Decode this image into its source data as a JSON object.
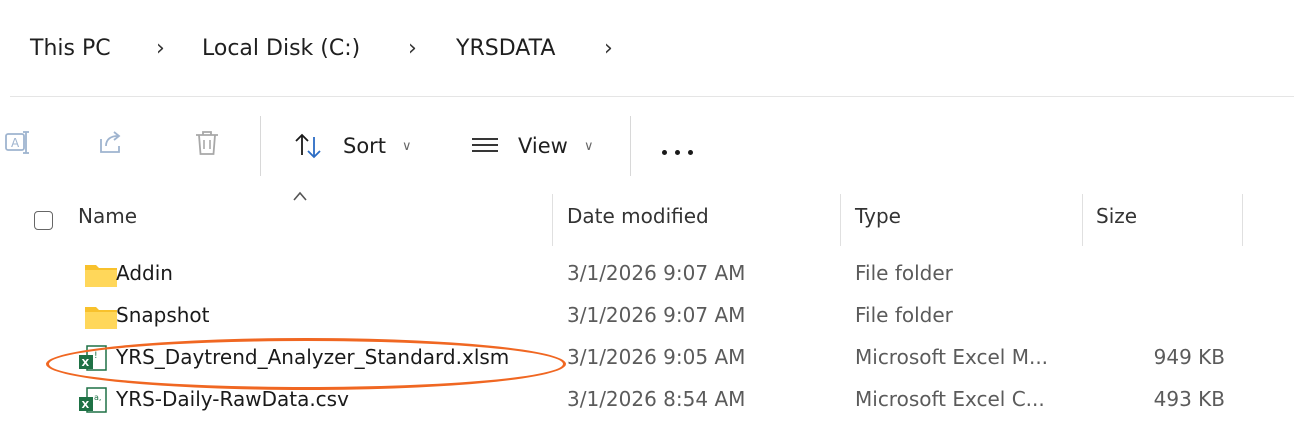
{
  "breadcrumb": {
    "items": [
      {
        "label": "This PC"
      },
      {
        "label": "Local Disk (C:)"
      },
      {
        "label": "YRSDATA"
      }
    ]
  },
  "toolbar": {
    "icons": [
      "rename-icon",
      "share-icon",
      "delete-icon"
    ],
    "sort_label": "Sort",
    "view_label": "View",
    "more_icon": "more-options-icon"
  },
  "columns": {
    "name": "Name",
    "date": "Date modified",
    "type": "Type",
    "size": "Size"
  },
  "files": [
    {
      "name": "Addin",
      "date": "3/1/2026 9:07 AM",
      "type": "File folder",
      "size": "",
      "icon": "folder-icon"
    },
    {
      "name": "Snapshot",
      "date": "3/1/2026 9:07 AM",
      "type": "File folder",
      "size": "",
      "icon": "folder-icon"
    },
    {
      "name": "YRS_Daytrend_Analyzer_Standard.xlsm",
      "date": "3/1/2026 9:05 AM",
      "type": "Microsoft Excel M...",
      "size": "949 KB",
      "icon": "excel-macro-icon"
    },
    {
      "name": "YRS-Daily-RawData.csv",
      "date": "3/1/2026 8:54 AM",
      "type": "Microsoft Excel C...",
      "size": "493 KB",
      "icon": "excel-csv-icon"
    }
  ],
  "colors": {
    "highlight": "#f06722",
    "folder": "#f8c12c",
    "excel": "#1e7145"
  }
}
